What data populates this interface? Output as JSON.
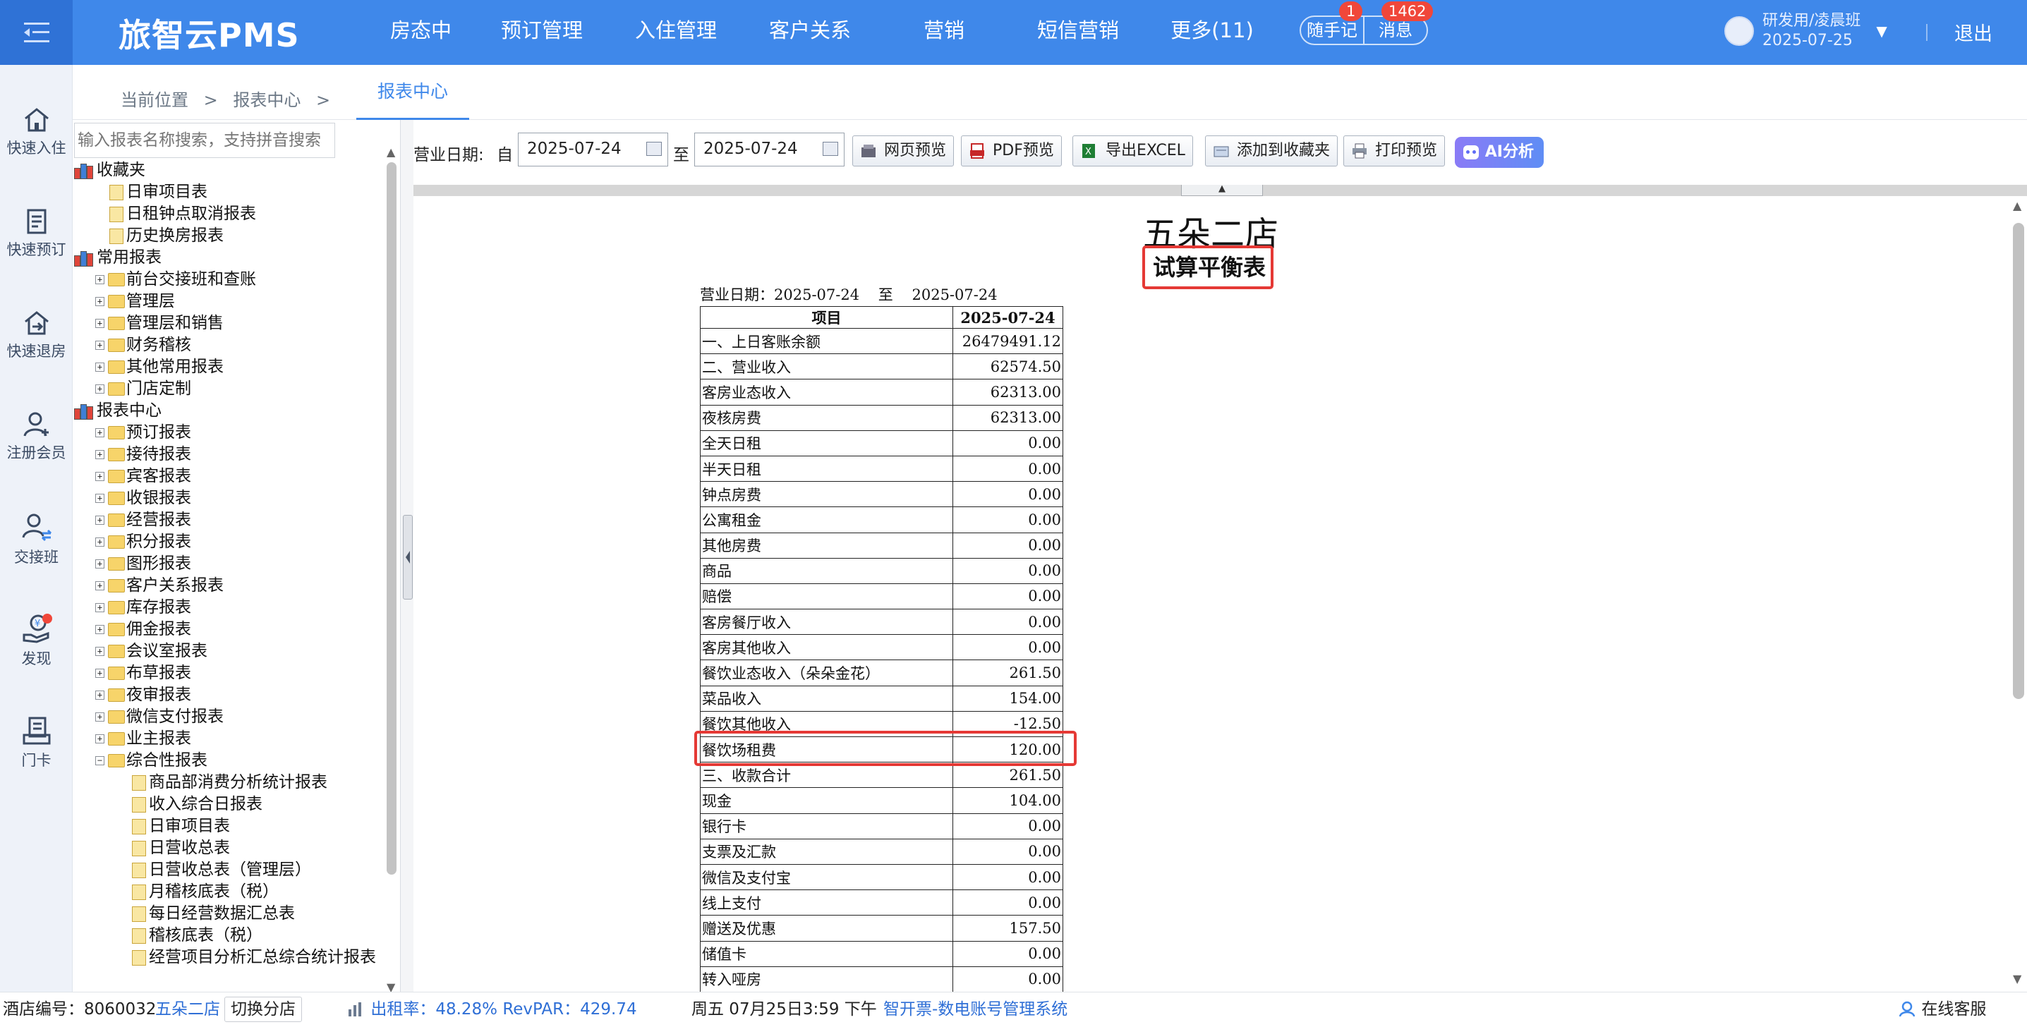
{
  "app": {
    "title": "旅智云PMS"
  },
  "nav": {
    "items": [
      "房态中心",
      "预订管理",
      "入住管理",
      "客户关系",
      "营销",
      "短信营销",
      "更多(11)"
    ]
  },
  "header_pills": {
    "memo": "随手记",
    "memo_badge": "1",
    "messages": "消息",
    "messages_badge": "1462"
  },
  "user": {
    "name": "研发用/凌晨班",
    "date": "2025-07-25",
    "logout": "退出"
  },
  "quickbar": {
    "items": [
      "快速入住",
      "快速预订",
      "快速退房",
      "注册会员",
      "交接班",
      "发现",
      "门卡"
    ]
  },
  "breadcrumb": {
    "label": "当前位置",
    "sep": ">",
    "section": "报表中心",
    "sep2": ">",
    "active_tab": "报表中心"
  },
  "search": {
    "placeholder": "输入报表名称搜索，支持拼音搜索"
  },
  "tree": [
    {
      "label": "收藏夹",
      "kind": "books",
      "depth": 0
    },
    {
      "label": "日审项目表",
      "kind": "doc",
      "depth": 1
    },
    {
      "label": "日租钟点取消报表",
      "kind": "doc",
      "depth": 1
    },
    {
      "label": "历史换房报表",
      "kind": "doc",
      "depth": 1
    },
    {
      "label": "常用报表",
      "kind": "books",
      "depth": 0
    },
    {
      "label": "前台交接班和查账",
      "kind": "folder",
      "depth": 1
    },
    {
      "label": "管理层",
      "kind": "folder",
      "depth": 1
    },
    {
      "label": "管理层和销售",
      "kind": "folder",
      "depth": 1
    },
    {
      "label": "财务稽核",
      "kind": "folder",
      "depth": 1
    },
    {
      "label": "其他常用报表",
      "kind": "folder",
      "depth": 1
    },
    {
      "label": "门店定制",
      "kind": "folder",
      "depth": 1
    },
    {
      "label": "报表中心",
      "kind": "books",
      "depth": 0
    },
    {
      "label": "预订报表",
      "kind": "folder",
      "depth": 1
    },
    {
      "label": "接待报表",
      "kind": "folder",
      "depth": 1
    },
    {
      "label": "宾客报表",
      "kind": "folder",
      "depth": 1
    },
    {
      "label": "收银报表",
      "kind": "folder",
      "depth": 1
    },
    {
      "label": "经营报表",
      "kind": "folder",
      "depth": 1
    },
    {
      "label": "积分报表",
      "kind": "folder",
      "depth": 1
    },
    {
      "label": "图形报表",
      "kind": "folder",
      "depth": 1
    },
    {
      "label": "客户关系报表",
      "kind": "folder",
      "depth": 1
    },
    {
      "label": "库存报表",
      "kind": "folder",
      "depth": 1
    },
    {
      "label": "佣金报表",
      "kind": "folder",
      "depth": 1
    },
    {
      "label": "会议室报表",
      "kind": "folder",
      "depth": 1
    },
    {
      "label": "布草报表",
      "kind": "folder",
      "depth": 1
    },
    {
      "label": "夜审报表",
      "kind": "folder",
      "depth": 1
    },
    {
      "label": "微信支付报表",
      "kind": "folder",
      "depth": 1
    },
    {
      "label": "业主报表",
      "kind": "folder",
      "depth": 1
    },
    {
      "label": "综合性报表",
      "kind": "openfolder",
      "depth": 1
    },
    {
      "label": "商品部消费分析统计报表",
      "kind": "doc",
      "depth": 2
    },
    {
      "label": "收入综合日报表",
      "kind": "doc",
      "depth": 2
    },
    {
      "label": "日审项目表",
      "kind": "doc",
      "depth": 2
    },
    {
      "label": "日营收总表",
      "kind": "doc",
      "depth": 2
    },
    {
      "label": "日营收总表（管理层）",
      "kind": "doc",
      "depth": 2
    },
    {
      "label": "月稽核底表（税）",
      "kind": "doc",
      "depth": 2
    },
    {
      "label": "每日经营数据汇总表",
      "kind": "doc",
      "depth": 2
    },
    {
      "label": "稽核底表（税）",
      "kind": "doc",
      "depth": 2
    },
    {
      "label": "经营项目分析汇总综合统计报表",
      "kind": "doc",
      "depth": 2
    }
  ],
  "toolbar": {
    "date_label": "营业日期:",
    "from_label": "自",
    "to_label": "至",
    "date_from": "2025-07-24",
    "date_to": "2025-07-24",
    "web_preview": "网页预览",
    "pdf_preview": "PDF预览",
    "export_excel": "导出EXCEL",
    "add_favorite": "添加到收藏夹",
    "print_preview": "打印预览",
    "ai_analysis": "AI分析"
  },
  "report": {
    "hotel_name": "五朵二店",
    "title": "试算平衡表",
    "date_prefix": "营业日期：",
    "date_from": "2025-07-24",
    "date_sep": "至",
    "date_to": "2025-07-24",
    "col_item": "项目",
    "col_date": "2025-07-24",
    "rows": [
      [
        "一、上日客账余额",
        "26479491.12"
      ],
      [
        "二、营业收入",
        "62574.50"
      ],
      [
        "客房业态收入",
        "62313.00"
      ],
      [
        "夜核房费",
        "62313.00"
      ],
      [
        "全天日租",
        "0.00"
      ],
      [
        "半天日租",
        "0.00"
      ],
      [
        "钟点房费",
        "0.00"
      ],
      [
        "公寓租金",
        "0.00"
      ],
      [
        "其他房费",
        "0.00"
      ],
      [
        "商品",
        "0.00"
      ],
      [
        "赔偿",
        "0.00"
      ],
      [
        "客房餐厅收入",
        "0.00"
      ],
      [
        "客房其他收入",
        "0.00"
      ],
      [
        "餐饮业态收入（朵朵金花）",
        "261.50"
      ],
      [
        "菜品收入",
        "154.00"
      ],
      [
        "餐饮其他收入",
        "-12.50"
      ],
      [
        "餐饮场租费",
        "120.00"
      ],
      [
        "三、收款合计",
        "261.50"
      ],
      [
        "现金",
        "104.00"
      ],
      [
        "银行卡",
        "0.00"
      ],
      [
        "支票及汇款",
        "0.00"
      ],
      [
        "微信及支付宝",
        "0.00"
      ],
      [
        "线上支付",
        "0.00"
      ],
      [
        "赠送及优惠",
        "157.50"
      ],
      [
        "储值卡",
        "0.00"
      ],
      [
        "转入哑房",
        "0.00"
      ]
    ]
  },
  "status": {
    "hotel_no_label": "酒店编号：",
    "hotel_no": "8060032",
    "hotel_name": "五朵二店",
    "switch": "切换分店",
    "occupancy": "出租率：48.28% RevPAR：429.74",
    "datetime": "周五 07月25日3:59 下午",
    "link": "智开票-数电账号管理系统",
    "support": "在线客服"
  },
  "colors": {
    "primary": "#3f88ea",
    "highlight_red": "#e53935",
    "badge_red": "#f0473a"
  }
}
